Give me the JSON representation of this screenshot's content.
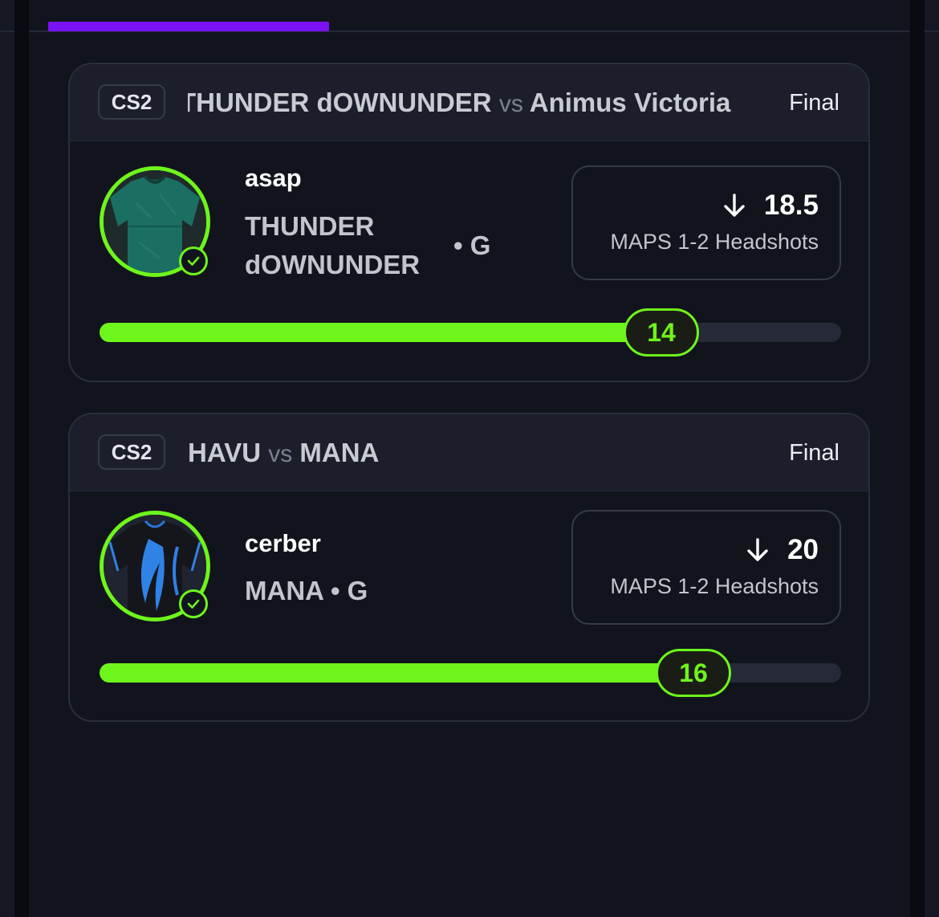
{
  "colors": {
    "accent": "#6ef51c",
    "tab_active": "#7a12f5",
    "background": "#12141d"
  },
  "cards": [
    {
      "game": "CS2",
      "team_a": "THUNDER dOWNUNDER",
      "vs": "vs",
      "team_b": "Animus Victoria",
      "status": "Final",
      "player": "asap",
      "team_line1": "THUNDER",
      "team_line2": "dOWNUNDER",
      "position": "• G",
      "direction": "down-arrow-icon",
      "line": "18.5",
      "stat": "MAPS 1-2 Headshots",
      "result": "14",
      "progress": 0.75
    },
    {
      "game": "CS2",
      "team_a": "HAVU",
      "vs": "vs",
      "team_b": "MANA",
      "status": "Final",
      "player": "cerber",
      "team": "MANA",
      "position": "• G",
      "direction": "down-arrow-icon",
      "line": "20",
      "stat": "MAPS 1-2 Headshots",
      "result": "16",
      "progress": 0.79
    }
  ]
}
